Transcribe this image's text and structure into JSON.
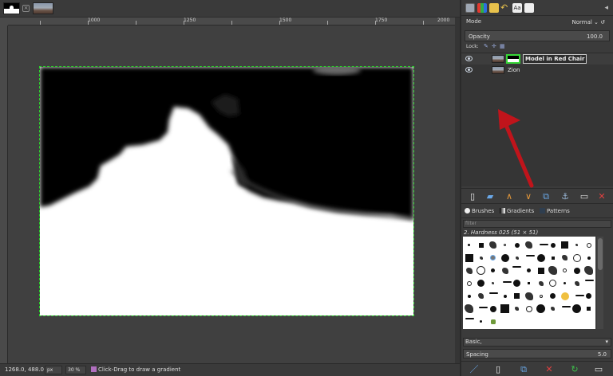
{
  "status": {
    "coords": "1268.0, 488.0",
    "unit": "px",
    "zoom": "30 %",
    "hint": "Click-Drag to draw a gradient"
  },
  "ruler": {
    "ticks": [
      "1000",
      "1250",
      "1500",
      "1750",
      "2000"
    ]
  },
  "layers": {
    "mode_label": "Mode",
    "mode_value": "Normal ⌄ ↺",
    "opacity_label": "Opacity",
    "opacity_value": "100.0",
    "lock_label": "Lock:",
    "items": [
      {
        "name": "Model in Red Chair",
        "selected": true
      },
      {
        "name": "Zion",
        "selected": false
      }
    ]
  },
  "brushes": {
    "tabs": [
      "Brushes",
      "Gradients",
      "Patterns"
    ],
    "filter_placeholder": "filter",
    "current_brush": "2. Hardness 025 (51 × 51)",
    "tag": "Basic,",
    "spacing_label": "Spacing",
    "spacing_value": "5.0"
  },
  "colors": {
    "mask_selection": "#2ed12e",
    "annotation_arrow": "#c0141b"
  },
  "icons": {
    "dock_tabs": [
      "layers-icon",
      "channels-icon",
      "paths-icon",
      "undo-history-icon",
      "fonts-icon",
      "images-icon"
    ],
    "layer_buttons": [
      "new-layer-icon",
      "new-layer-group-icon",
      "raise-layer-icon",
      "lower-layer-icon",
      "duplicate-layer-icon",
      "anchor-layer-icon",
      "add-mask-icon",
      "delete-layer-icon"
    ],
    "brush_buttons": [
      "edit-brush-icon",
      "new-brush-icon",
      "duplicate-brush-icon",
      "delete-brush-icon",
      "refresh-brushes-icon",
      "open-brush-as-image-icon"
    ]
  }
}
